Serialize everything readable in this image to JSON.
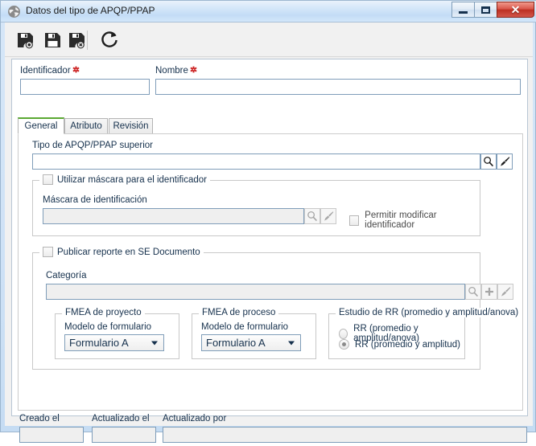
{
  "window": {
    "title": "Datos del tipo de APQP/PPAP",
    "app_icon": "globe-icon",
    "buttons": {
      "minimize": "minimize-icon",
      "maximize": "maximize-icon",
      "close": "close-icon"
    }
  },
  "toolbar": {
    "items": [
      {
        "name": "save-and-new-button",
        "icon": "save-add-icon",
        "tooltip": "Guardar y nuevo"
      },
      {
        "name": "save-button",
        "icon": "save-icon",
        "tooltip": "Guardar"
      },
      {
        "name": "save-and-close-button",
        "icon": "save-close-icon",
        "tooltip": "Guardar y cerrar"
      },
      {
        "name": "refresh-button",
        "icon": "refresh-icon",
        "tooltip": "Actualizar"
      }
    ]
  },
  "header": {
    "identificador": {
      "label": "Identificador",
      "required": true,
      "value": "",
      "placeholder": ""
    },
    "nombre": {
      "label": "Nombre",
      "required": true,
      "value": "",
      "placeholder": ""
    }
  },
  "tabs": [
    {
      "label": "General",
      "active": true
    },
    {
      "label": "Atributo",
      "active": false
    },
    {
      "label": "Revisión",
      "active": false
    }
  ],
  "general": {
    "tipo_superior": {
      "label": "Tipo de APQP/PPAP superior",
      "value": "",
      "search_icon": "search-icon",
      "clear_icon": "brush-icon"
    },
    "mascara_group": {
      "checkbox_label": "Utilizar máscara para el identificador",
      "checked": false,
      "mascara_field": {
        "label": "Máscara de identificación",
        "value": "",
        "disabled": true,
        "search_icon": "search-icon",
        "clear_icon": "brush-icon"
      },
      "permitir_modificar": {
        "label": "Permitir modificar identificador",
        "checked": false,
        "disabled": true
      }
    },
    "publicar_group": {
      "checkbox_label": "Publicar reporte en SE Documento",
      "checked": false,
      "categoria": {
        "label": "Categoría",
        "value": "",
        "disabled": true,
        "search_icon": "search-icon",
        "add_icon": "plus-icon",
        "clear_icon": "brush-icon"
      },
      "fmea_proyecto": {
        "title": "FMEA de proyecto",
        "field_label": "Modelo de formulario",
        "selected": "Formulario A"
      },
      "fmea_proceso": {
        "title": "FMEA de proceso",
        "field_label": "Modelo de formulario",
        "selected": "Formulario A"
      },
      "estudio_rr": {
        "title": "Estudio de RR (promedio y amplitud/anova)",
        "options": [
          {
            "label": "RR (promedio y amplitud/anova)",
            "selected": false
          },
          {
            "label": "RR (promedio y amplitud)",
            "selected": true
          }
        ]
      }
    }
  },
  "audit": {
    "creado_el": {
      "label": "Creado el",
      "value": "",
      "disabled": true
    },
    "actualizado_el": {
      "label": "Actualizado el",
      "value": "",
      "disabled": true
    },
    "actualizado_por": {
      "label": "Actualizado por",
      "value": "",
      "disabled": true
    }
  },
  "colors": {
    "titlebar": "#cfe4f8",
    "accent_tab": "#5aa832",
    "required_marker": "#cc2020",
    "close_button": "#bc2f22",
    "field_border": "#7f9db9"
  }
}
